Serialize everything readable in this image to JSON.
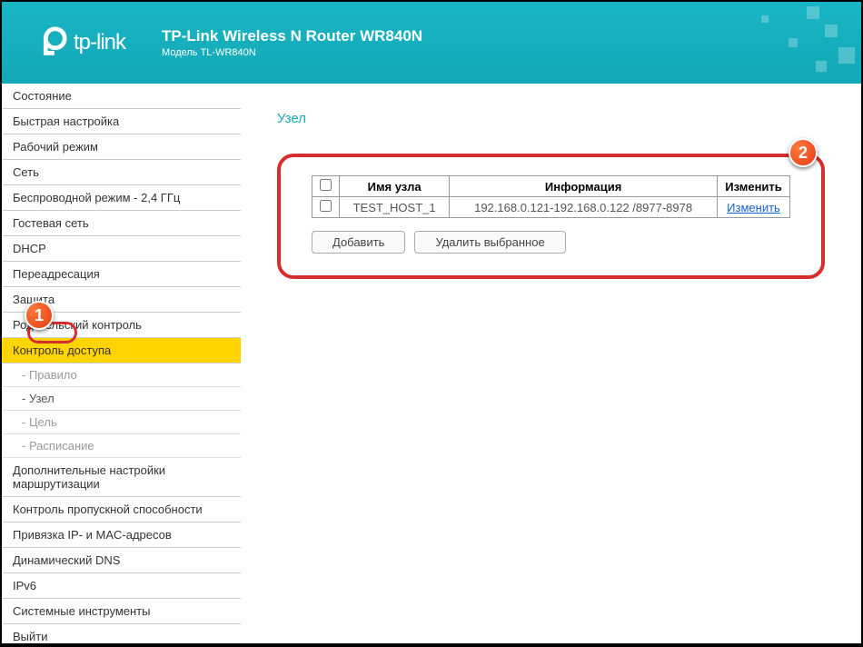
{
  "header": {
    "logo_text": "tp-link",
    "title": "TP-Link Wireless N Router WR840N",
    "model": "Модель TL-WR840N"
  },
  "menu": {
    "items": [
      "Состояние",
      "Быстрая настройка",
      "Рабочий режим",
      "Сеть",
      "Беспроводной режим - 2,4 ГГц",
      "Гостевая сеть",
      "DHCP",
      "Переадресация",
      "Защита",
      "Родительский контроль"
    ],
    "active": "Контроль доступа",
    "subs": {
      "rule": "- Правило",
      "host": "- Узел",
      "target": "- Цель",
      "schedule": "- Расписание"
    },
    "items2": [
      "Дополнительные настройки маршрутизации",
      "Контроль пропускной способности",
      "Привязка IP- и MAC-адресов",
      "Динамический DNS",
      "IPv6",
      "Системные инструменты",
      "Выйти"
    ]
  },
  "content": {
    "title": "Узел",
    "table": {
      "headers": {
        "name": "Имя узла",
        "info": "Информация",
        "edit": "Изменить"
      },
      "row": {
        "name": "TEST_HOST_1",
        "info": "192.168.0.121-192.168.0.122 /8977-8978",
        "edit": "Изменить"
      }
    },
    "buttons": {
      "add": "Добавить",
      "delete": "Удалить выбранное"
    }
  },
  "callouts": {
    "c1": "1",
    "c2": "2"
  }
}
